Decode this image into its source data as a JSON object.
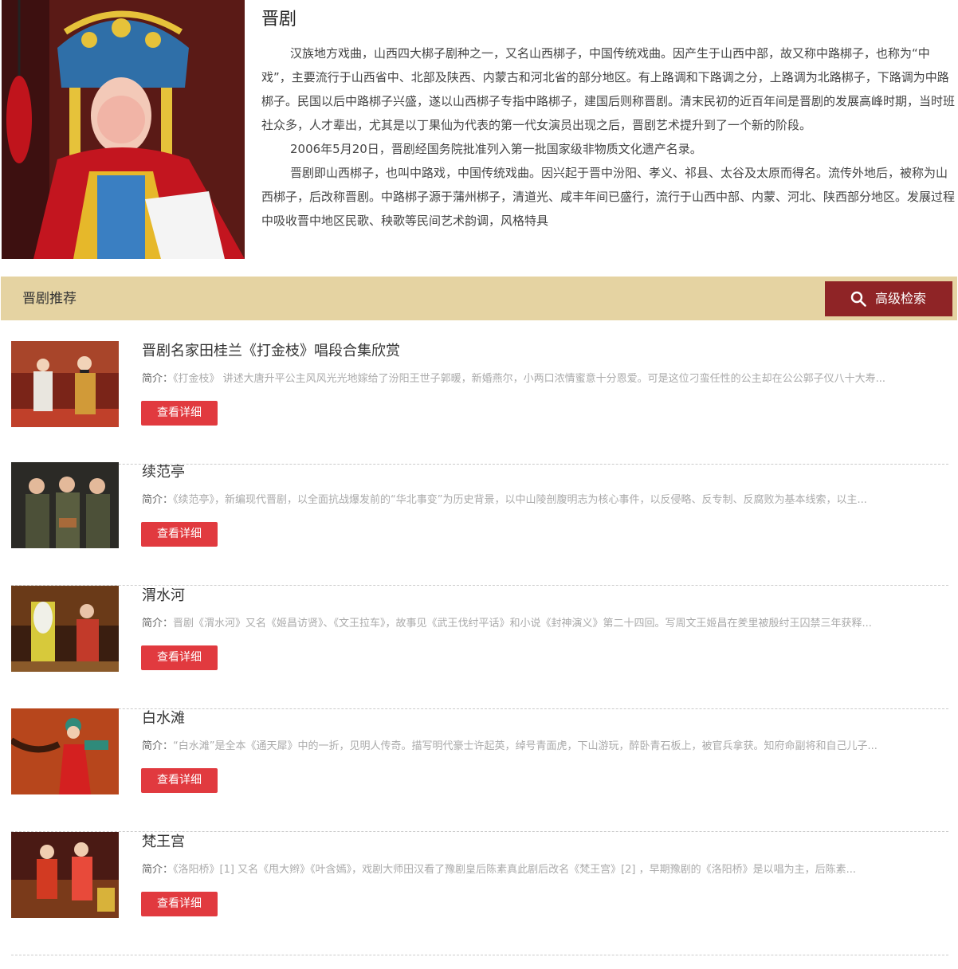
{
  "intro": {
    "title": "晋剧",
    "paragraphs": [
      "汉族地方戏曲，山西四大梆子剧种之一，又名山西梆子，中国传统戏曲。因产生于山西中部，故又称中路梆子，也称为“中戏”，主要流行于山西省中、北部及陕西、内蒙古和河北省的部分地区。有上路调和下路调之分，上路调为北路梆子，下路调为中路梆子。民国以后中路梆子兴盛，遂以山西梆子专指中路梆子，建国后则称晋剧。清末民初的近百年间是晋剧的发展高峰时期，当时班社众多，人才辈出，尤其是以丁果仙为代表的第一代女演员出现之后，晋剧艺术提升到了一个新的阶段。",
      "2006年5月20日，晋剧经国务院批准列入第一批国家级非物质文化遗产名录。",
      "晋剧即山西梆子，也叫中路戏，中国传统戏曲。因兴起于晋中汾阳、孝义、祁县、太谷及太原而得名。流传外地后，被称为山西梆子，后改称晋剧。中路梆子源于蒲州梆子，清道光、咸丰年间已盛行，流行于山西中部、内蒙、河北、陕西部分地区。发展过程中吸收晋中地区民歌、秧歌等民间艺术韵调，风格特具"
    ]
  },
  "recommend": {
    "title": "晋剧推荐",
    "search_label": "高级检索"
  },
  "desc_label": "简介：",
  "detail_label": "查看详细",
  "items": [
    {
      "title": "晋剧名家田桂兰《打金枝》唱段合集欣赏",
      "desc": "《打金枝》 讲述大唐升平公主风风光光地嫁给了汾阳王世子郭暖，新婚燕尔，小两口浓情蜜意十分恩爱。可是这位刁蛮任性的公主却在公公郭子仪八十大寿..."
    },
    {
      "title": "续范亭",
      "desc": "《续范亭》，新编现代晋剧，以全面抗战爆发前的“华北事变”为历史背景，以中山陵剖腹明志为核心事件，以反侵略、反专制、反腐败为基本线索，以主..."
    },
    {
      "title": "渭水河",
      "desc": "晋剧《渭水河》又名《姬昌访贤》、《文王拉车》，故事见《武王伐纣平话》和小说《封神演义》第二十四回。写周文王姬昌在羑里被殷纣王囚禁三年获释..."
    },
    {
      "title": "白水滩",
      "desc": "“白水滩”是全本《通天犀》中的一折，见明人传奇。描写明代豪士许起英，绰号青面虎，下山游玩，醉卧青石板上，被官兵拿获。知府命副将和自己儿子..."
    },
    {
      "title": "梵王宫",
      "desc": "《洛阳桥》[1] 又名《甩大辫》《叶含嫣》，戏剧大师田汉看了豫剧皇后陈素真此剧后改名《梵王宫》[2] ，早期豫剧的《洛阳桥》是以唱为主，后陈素..."
    }
  ]
}
